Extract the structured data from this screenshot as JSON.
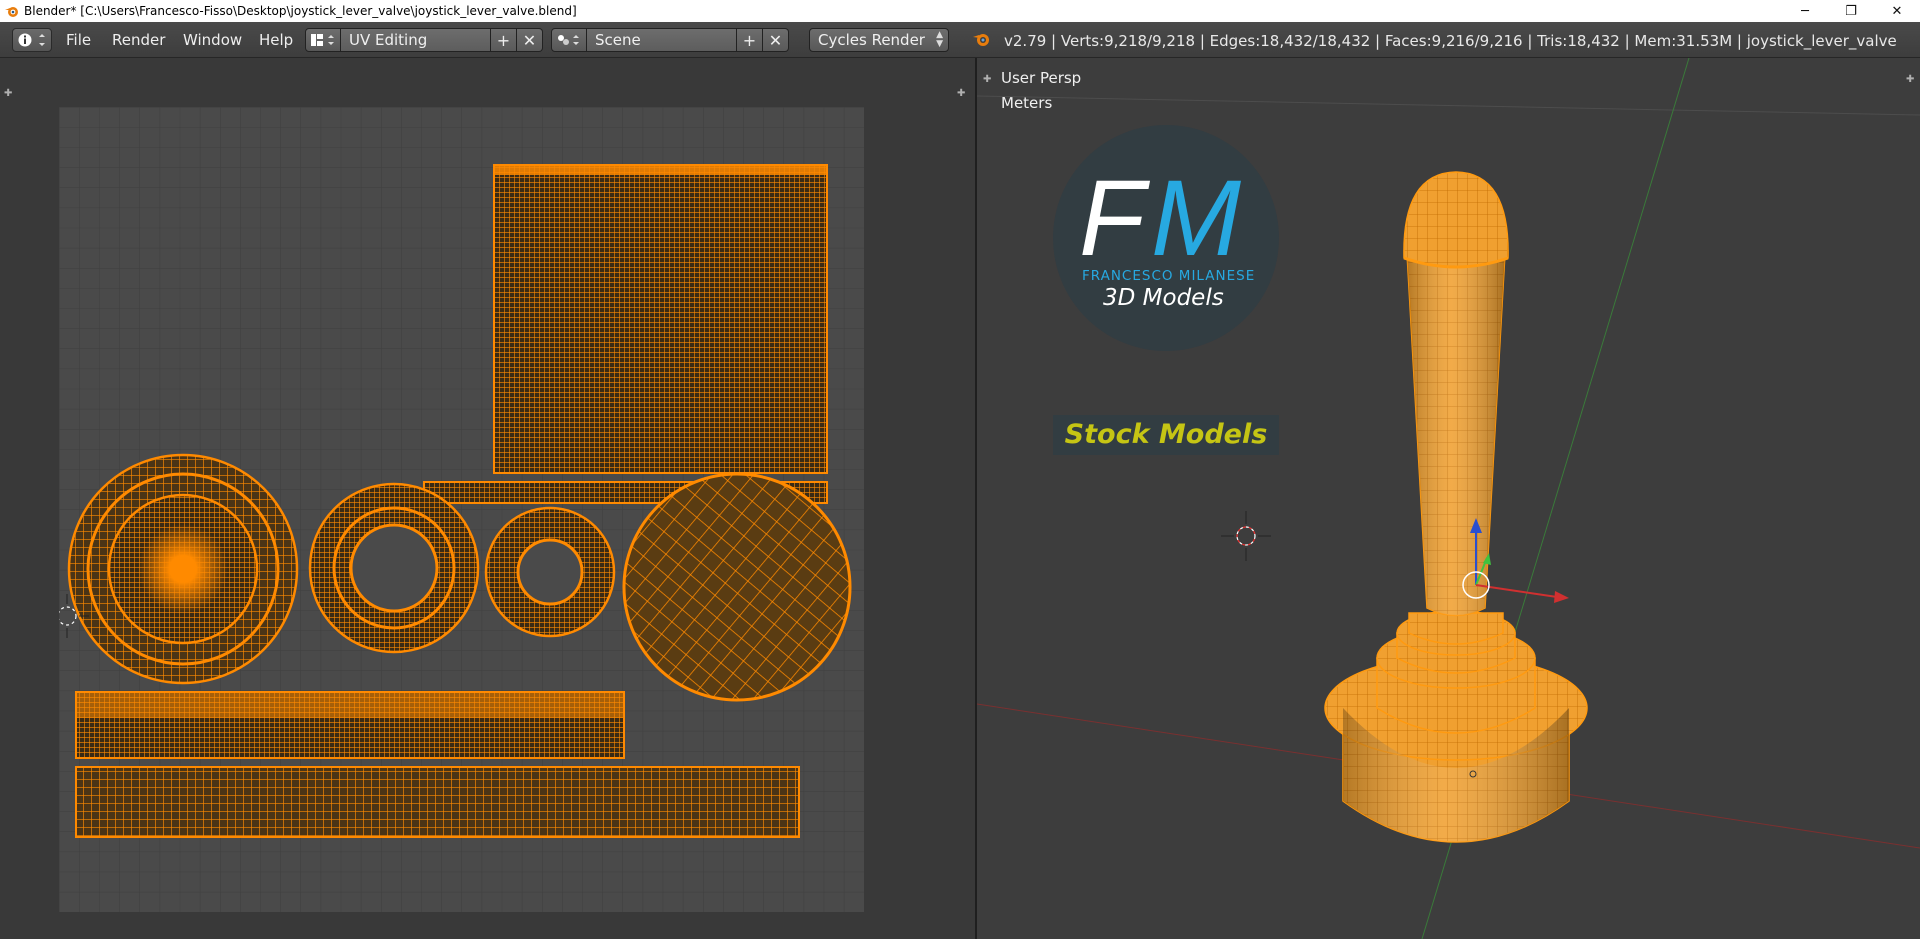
{
  "window": {
    "title": "Blender* [C:\\Users\\Francesco-Fisso\\Desktop\\joystick_lever_valve\\joystick_lever_valve.blend]",
    "minimize_glyph": "─",
    "maximize_glyph": "❐",
    "close_glyph": "✕"
  },
  "menu": {
    "editor_type_icon": "info-icon",
    "items": [
      "File",
      "Render",
      "Window",
      "Help"
    ]
  },
  "screen_layout": {
    "value": "UV Editing",
    "add_glyph": "+",
    "remove_glyph": "✕"
  },
  "scene": {
    "value": "Scene",
    "add_glyph": "+",
    "remove_glyph": "✕"
  },
  "render_engine": {
    "value": "Cycles Render"
  },
  "stats": "v2.79 | Verts:9,218/9,218 | Edges:18,432/18,432 | Faces:9,216/9,216 | Tris:18,432 | Mem:31.53M | joystick_lever_valve",
  "viewport": {
    "view_name": "User Persp",
    "units": "Meters"
  },
  "logo": {
    "letter_f": "F",
    "letter_m": "M",
    "brand": "FRANCESCO MILANESE",
    "subtitle": "3D Models",
    "badge": "Stock Models"
  },
  "colors": {
    "uv_mesh": "#ff8a00",
    "uv_background": "#4a4a4a",
    "model_fill": "#f0a030",
    "model_wire": "#ff9a10",
    "logo_blue": "#27a9e1",
    "badge_text": "#c5c514"
  }
}
